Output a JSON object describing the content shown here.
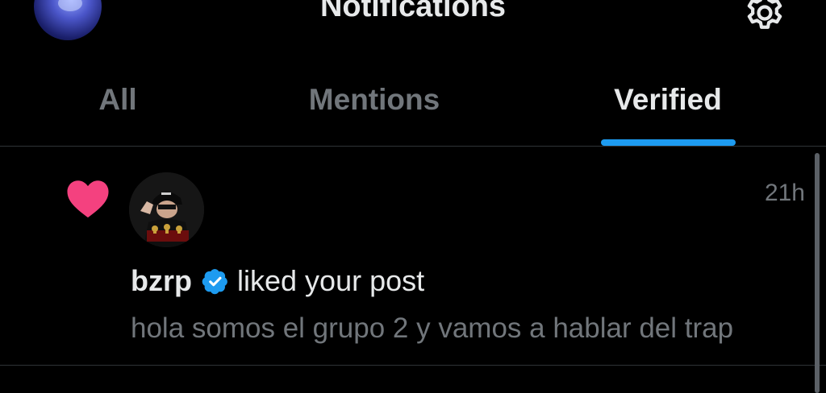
{
  "header": {
    "title": "Notifications",
    "settings_icon": "gear-icon"
  },
  "tabs": [
    {
      "label": "All",
      "active": false
    },
    {
      "label": "Mentions",
      "active": false
    },
    {
      "label": "Verified",
      "active": true
    }
  ],
  "colors": {
    "accent": "#1d9bf0",
    "like": "#f91880",
    "text_primary": "#e7e9ea",
    "text_secondary": "#71767b",
    "background": "#000000"
  },
  "notifications": [
    {
      "type_icon": "heart-icon",
      "username": "bzrp",
      "verified": true,
      "action": "liked your post",
      "post_text": "hola somos el grupo 2 y vamos a hablar del trap",
      "time": "21h"
    }
  ]
}
